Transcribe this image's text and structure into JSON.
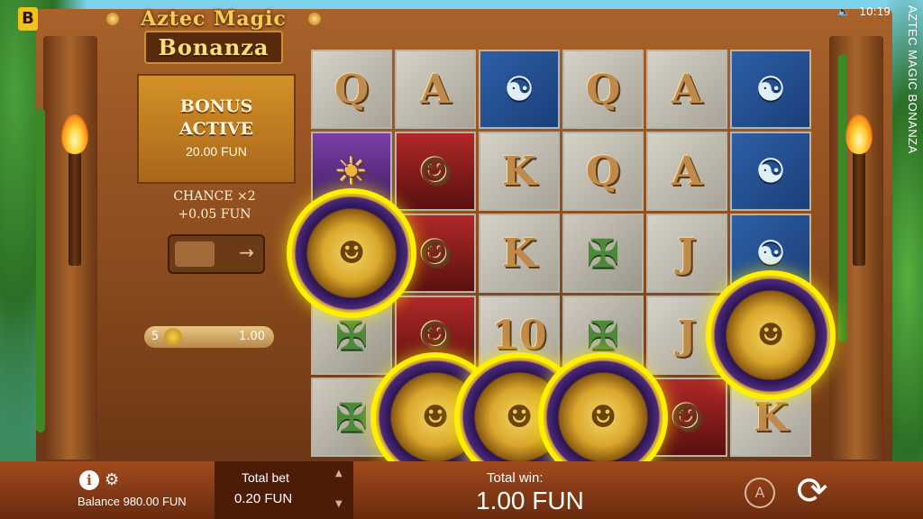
{
  "brand_badge": "B",
  "logo": {
    "line1": "Aztec Magic",
    "line2": "Bonanza"
  },
  "status": {
    "time": "10:19",
    "sound_icon": "speaker-icon"
  },
  "vertical_title": "AZTEC MAGIC BONANZA",
  "bonus_panel": {
    "title_line1": "BONUS",
    "title_line2": "ACTIVE",
    "amount": "20.00 FUN"
  },
  "chance": {
    "line1": "CHANCE ×2",
    "line2": "+0.05 FUN"
  },
  "toggle": {
    "arrow": "→"
  },
  "payline": {
    "count": "5",
    "value": "1.00"
  },
  "reels": [
    [
      "Q",
      "chief",
      "coin",
      "bird-skip",
      "bird-skip"
    ],
    [
      "A",
      "woman",
      "woman",
      "woman",
      "coin"
    ],
    [
      "bird",
      "K",
      "K",
      "10",
      "coin"
    ],
    [
      "Q",
      "Q",
      "mask",
      "mask",
      "coin"
    ],
    [
      "A",
      "A",
      "J",
      "J",
      "woman"
    ],
    [
      "bird",
      "bird",
      "bird",
      "coin",
      "K"
    ]
  ],
  "symbols": {
    "A": "A",
    "K": "K",
    "Q": "Q",
    "J": "J",
    "10": "10",
    "bird": "☯",
    "mask": "✠",
    "woman": "☺",
    "chief": "☀",
    "coin": "☻"
  },
  "bottom": {
    "info": "i",
    "balance": "Balance 980.00 FUN",
    "total_bet_label": "Total bet",
    "total_bet_value": "0.20 FUN",
    "total_win_label": "Total win:",
    "total_win_value": "1.00 FUN",
    "auto_label": "A",
    "spin_glyph": "⟳"
  },
  "colors": {
    "coin_glow": "#fff000",
    "bar": "#a04a1e",
    "bonus_panel": "#d39227"
  }
}
